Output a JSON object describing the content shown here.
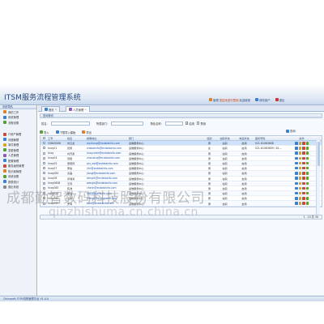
{
  "app": {
    "title": "ITSM服务流程管理系统",
    "footer": "Chinasoft-ITSM流程管理平台 V1.0.0"
  },
  "header": {
    "user_label": "管理",
    "user_warn": "您还未进行签到",
    "welcome": "欢迎使用",
    "items": [
      {
        "label": "修改用户",
        "color": "#3b7fcf"
      },
      {
        "label": "退出",
        "color": "#c33"
      }
    ]
  },
  "sidebar": {
    "head1": "系统导航",
    "top_items": [
      {
        "label": "我的工作",
        "color": "#d9822b"
      },
      {
        "label": "系统管理",
        "color": "#3b7fcf"
      },
      {
        "label": "流程设置",
        "color": "#5a9e3a"
      }
    ],
    "menu_items": [
      {
        "label": "IT资产管理",
        "color": "#c84a3a"
      },
      {
        "label": "问题管理",
        "color": "#3b7fcf"
      },
      {
        "label": "事件管理",
        "color": "#d9a22b"
      },
      {
        "label": "变更管理",
        "color": "#5a9e3a"
      },
      {
        "label": "人员管理",
        "color": "#8a5ab8"
      },
      {
        "label": "配置管理",
        "color": "#3b7fcf"
      },
      {
        "label": "服务级别管理",
        "color": "#c84a3a"
      },
      {
        "label": "知识库管理",
        "color": "#d9822b"
      },
      {
        "label": "系统设置",
        "color": "#5a9e3a"
      },
      {
        "label": "报表统计",
        "color": "#3b7fcf"
      },
      {
        "label": "退出系统",
        "color": "#888888"
      }
    ]
  },
  "tabs": [
    {
      "label": "首页"
    },
    {
      "label": "人员管理"
    }
  ],
  "panel": {
    "title": "查询条件"
  },
  "search": {
    "name_label": "姓名：",
    "name_value": "",
    "dept_label": "所属部门：",
    "dept_value": "",
    "role_label": "角色名称：",
    "role_value": "",
    "chk1_label": "启用",
    "chk2_label": "禁用",
    "btn_label": "查询"
  },
  "toolbar": {
    "buttons": [
      {
        "label": "导入",
        "color": "#5a9e3a"
      },
      {
        "label": "下载导入模板",
        "color": "#3b7fcf"
      },
      {
        "label": "导出",
        "color": "#d9822b"
      }
    ]
  },
  "grid": {
    "headers": [
      "工号",
      "姓名",
      "邮箱地址",
      "部门",
      "性别",
      "在职状态",
      "电话状态",
      "座机号码",
      "操作"
    ],
    "rows": [
      {
        "id": "CS800008",
        "name": "刘云龙",
        "mail": "wyzhong@ecdatainfo.com",
        "dept": "运维服务中心",
        "sex": "男",
        "role": "在职",
        "state": "启用",
        "phone": "021-61063608",
        "sel": true
      },
      {
        "id": "hcoy01",
        "name": "张勇",
        "mail": "zhabeiinfo@ecdatainfo.com",
        "dept": "运维服务中心",
        "sex": "女",
        "role": "在职",
        "state": "启用",
        "phone": "021-61063609 / 61...",
        "sel": false
      },
      {
        "id": "hcoy",
        "name": "刘齐勇",
        "mail": "huayuinfo@ecdatainfo.com",
        "dept": "运维服务中心",
        "sex": "男",
        "role": "在职",
        "state": "启用",
        "phone": "",
        "sel": false
      },
      {
        "id": "hcoy04",
        "name": "周晓",
        "mail": "zhouxing@ecdatainfo.com",
        "dept": "运维服务中心",
        "sex": "男",
        "role": "在职",
        "state": "启用",
        "phone": "",
        "sel": false
      },
      {
        "id": "hcoy05",
        "name": "吴晓伟",
        "mail": "qiu_wei@ecdatainfo.com",
        "dept": "运维服务中心",
        "sex": "男",
        "role": "在职",
        "state": "启用",
        "phone": "",
        "sel": false
      },
      {
        "id": "hcoy07",
        "name": "李俊",
        "mail": "lihn@ecdatainfo.com",
        "dept": "运维服务中心",
        "sex": "男",
        "role": "在职",
        "state": "启用",
        "phone": "",
        "sel": false
      },
      {
        "id": "hcoy063",
        "name": "姜磊",
        "mail": "jiangl@ecdatainfo.com",
        "dept": "运维服务中心",
        "sex": "男",
        "role": "在职",
        "state": "启用",
        "phone": "",
        "sel": false
      },
      {
        "id": "hcoy06",
        "name": "邓瑞鸿",
        "mail": "dengrh@ecdatainfo.com",
        "dept": "运维服务中心",
        "sex": "男",
        "role": "在职",
        "state": "启用",
        "phone": "",
        "sel": false
      },
      {
        "id": "hcoy0608",
        "name": "王伟",
        "mail": "wangw@ecdatainfo.com",
        "dept": "运维服务中心",
        "sex": "男",
        "role": "在职",
        "state": "启用",
        "phone": "",
        "sel": false
      },
      {
        "id": "hcoy085",
        "name": "陈浩",
        "mail": "chenh@ecdatainfo.com",
        "dept": "运维服务中心",
        "sex": "男",
        "role": "在职",
        "state": "启用",
        "phone": "",
        "sel": false
      },
      {
        "id": "hcoy092",
        "name": "李强",
        "mail": "liq@ecdatainfo.com",
        "dept": "运维服务中心",
        "sex": "男",
        "role": "在职",
        "state": "启用",
        "phone": "",
        "sel": false
      },
      {
        "id": "hcoy065",
        "name": "王斌",
        "mail": "wangb@ecdatainfo.com",
        "dept": "运维服务中心",
        "sex": "男",
        "role": "在职",
        "state": "启用",
        "phone": "",
        "sel": false
      },
      {
        "id": "hcoy069",
        "name": "罗鸿",
        "mail": "luoh@ecdatainfo.com",
        "dept": "运维服务中心",
        "sex": "男",
        "role": "在职",
        "state": "启用",
        "phone": "",
        "sel": false
      }
    ],
    "footer": "1 - 15 共 30"
  },
  "watermark": {
    "text": "成都勤智数码科技股份有限公司",
    "url": "qinzhishuma.cn.china.cn"
  }
}
